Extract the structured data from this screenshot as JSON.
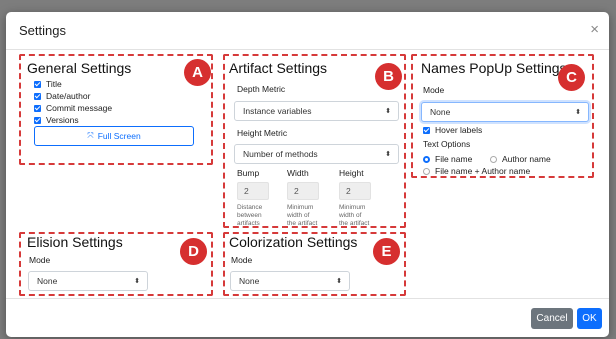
{
  "dialog": {
    "title": "Settings",
    "close_glyph": "×"
  },
  "general": {
    "title": "General Settings",
    "badge": "A",
    "checks": [
      {
        "label": "Title",
        "checked": true
      },
      {
        "label": "Date/author",
        "checked": true
      },
      {
        "label": "Commit message",
        "checked": true
      },
      {
        "label": "Versions",
        "checked": true
      }
    ],
    "fullscreen_label": "Full Screen",
    "fullscreen_icon": "expand-icon"
  },
  "artifact": {
    "title": "Artifact Settings",
    "badge": "B",
    "depth_label": "Depth Metric",
    "depth_value": "Instance variables",
    "height_label": "Height Metric",
    "height_value": "Number of methods",
    "bump_label": "Bump",
    "width_label": "Width",
    "height_col_label": "Height",
    "bump_value": "2",
    "width_value": "2",
    "height_value2": "2",
    "bump_desc": [
      "Distance",
      "between",
      "artifacts"
    ],
    "width_desc": [
      "Minimum",
      "width of",
      "the artifact"
    ],
    "height_desc": [
      "Minimum",
      "width of",
      "the artifact"
    ]
  },
  "names": {
    "title": "Names PopUp Settings",
    "badge": "C",
    "mode_label": "Mode",
    "mode_value": "None",
    "hover_label": "Hover labels",
    "hover_checked": true,
    "text_options_label": "Text Options",
    "radios": [
      {
        "label": "File name",
        "selected": true
      },
      {
        "label": "Author name",
        "selected": false
      },
      {
        "label": "File name + Author name",
        "selected": false
      }
    ]
  },
  "elision": {
    "title": "Elision Settings",
    "badge": "D",
    "mode_label": "Mode",
    "mode_value": "None"
  },
  "colorization": {
    "title": "Colorization Settings",
    "badge": "E",
    "mode_label": "Mode",
    "mode_value": "None"
  },
  "footer": {
    "cancel_label": "Cancel",
    "ok_label": "OK"
  },
  "select_arrow": "⬍",
  "colors": {
    "accent": "#0d6efd",
    "badge": "#d62f2f",
    "dash": "#d63a3a",
    "cancel": "#6c757d"
  }
}
